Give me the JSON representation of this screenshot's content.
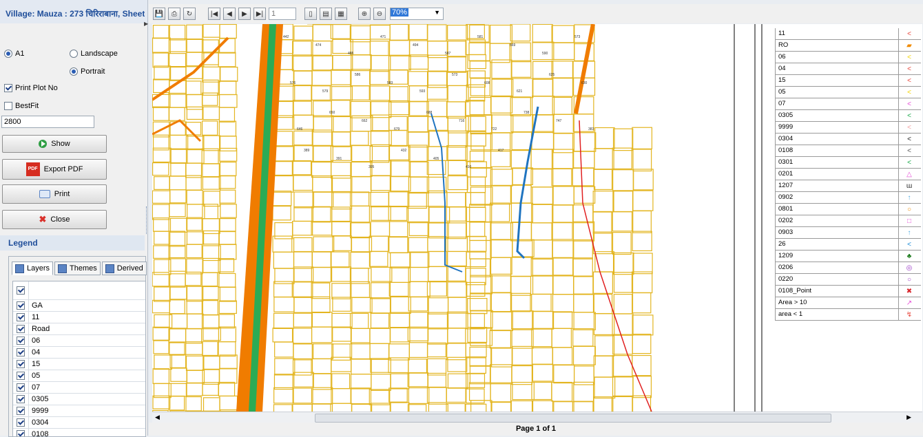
{
  "village_title": "Village: Mauza : 273 चिरिराबाना, Sheet",
  "page_size": {
    "a1": "A1",
    "landscape": "Landscape",
    "portrait": "Portrait"
  },
  "options": {
    "print_plot_no": "Print Plot No",
    "bestfit": "BestFit",
    "scale_value": "2800"
  },
  "buttons": {
    "show": "Show",
    "export_pdf": "Export PDF",
    "print": "Print",
    "close": "Close",
    "pdf_tag": "PDF"
  },
  "legend": {
    "title": "Legend",
    "tabs": [
      "Layers",
      "Themes",
      "Derived"
    ]
  },
  "layers": [
    "GA",
    "11",
    "Road",
    "06",
    "04",
    "15",
    "05",
    "07",
    "0305",
    "9999",
    "0304",
    "0108"
  ],
  "toolbar": {
    "page_input": "1",
    "zoom": "70%"
  },
  "status": {
    "page": "Page 1 of 1"
  },
  "map_legend": [
    {
      "label": "11",
      "color": "#e8463c"
    },
    {
      "label": "RO",
      "color": "#f08a00"
    },
    {
      "label": "06",
      "color": "#f2d300"
    },
    {
      "label": "04",
      "color": "#e8463c"
    },
    {
      "label": "15",
      "color": "#e8463c"
    },
    {
      "label": "05",
      "color": "#f2d300"
    },
    {
      "label": "07",
      "color": "#e54bd6"
    },
    {
      "label": "0305",
      "color": "#1aa84a"
    },
    {
      "label": "9999",
      "color": "#f2a0a0"
    },
    {
      "label": "0304",
      "color": "#222222"
    },
    {
      "label": "0108",
      "color": "#555555"
    },
    {
      "label": "0301",
      "color": "#1aa84a"
    },
    {
      "label": "0201",
      "color": "#e54bd6"
    },
    {
      "label": "1207",
      "color": "#222222"
    },
    {
      "label": "0902",
      "color": "#4aa8e0"
    },
    {
      "label": "0801",
      "color": "#f08a00"
    },
    {
      "label": "0202",
      "color": "#e54bd6"
    },
    {
      "label": "0903",
      "color": "#4aa8e0"
    },
    {
      "label": "26",
      "color": "#1a8ad6"
    },
    {
      "label": "1209",
      "color": "#1a7a1a"
    },
    {
      "label": "0206",
      "color": "#9b3cc7"
    },
    {
      "label": "0220",
      "color": "#9b3cc7"
    },
    {
      "label": "0108_Point",
      "color": "#d8262c"
    },
    {
      "label": "Area > 10",
      "color": "#e54bd6"
    },
    {
      "label": "area < 1",
      "color": "#e8463c"
    }
  ],
  "map_legend_symbols": [
    "<",
    "▰",
    "<",
    "<",
    "<",
    "<",
    "<",
    "<",
    "<",
    "<",
    "<",
    "<",
    "△",
    "ɯ",
    "↑",
    "○",
    "□",
    "↑",
    "<",
    "♣",
    "◎",
    "○",
    "✖",
    "↗",
    "↯"
  ],
  "plot_numbers": [
    "442",
    "474",
    "485",
    "471",
    "494",
    "587",
    "581",
    "569",
    "590",
    "573",
    "576",
    "579",
    "586",
    "583",
    "593",
    "573",
    "608",
    "621",
    "625",
    "630",
    "646",
    "650",
    "662",
    "679",
    "688",
    "716",
    "722",
    "738",
    "747",
    "383",
    "389",
    "391",
    "395",
    "432",
    "405",
    "410",
    "417"
  ]
}
